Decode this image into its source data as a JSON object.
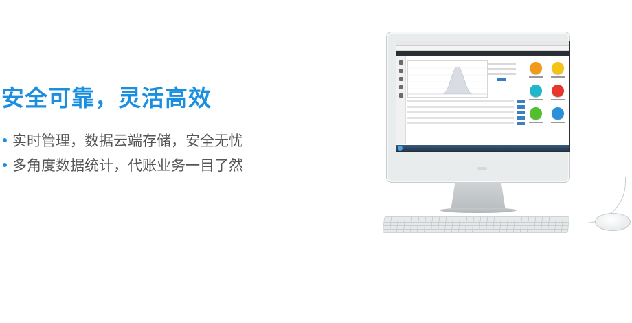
{
  "headline": "安全可靠，灵活高效",
  "features": [
    "实时管理，数据云端存储，安全无忧",
    "多角度数据统计，代账业务一目了然"
  ],
  "colors": {
    "accent": "#1a8fe0",
    "body_text": "#555555"
  },
  "screen_icons": [
    {
      "icon": "orange-circle",
      "color": "#f19a1a"
    },
    {
      "icon": "yellow-circle",
      "color": "#f3c413"
    },
    {
      "icon": "teal-circle",
      "color": "#21b6c9"
    },
    {
      "icon": "red-circle",
      "color": "#e8362b"
    },
    {
      "icon": "green-circle",
      "color": "#53bf2f"
    },
    {
      "icon": "blue-circle",
      "color": "#2b8fd9"
    }
  ]
}
